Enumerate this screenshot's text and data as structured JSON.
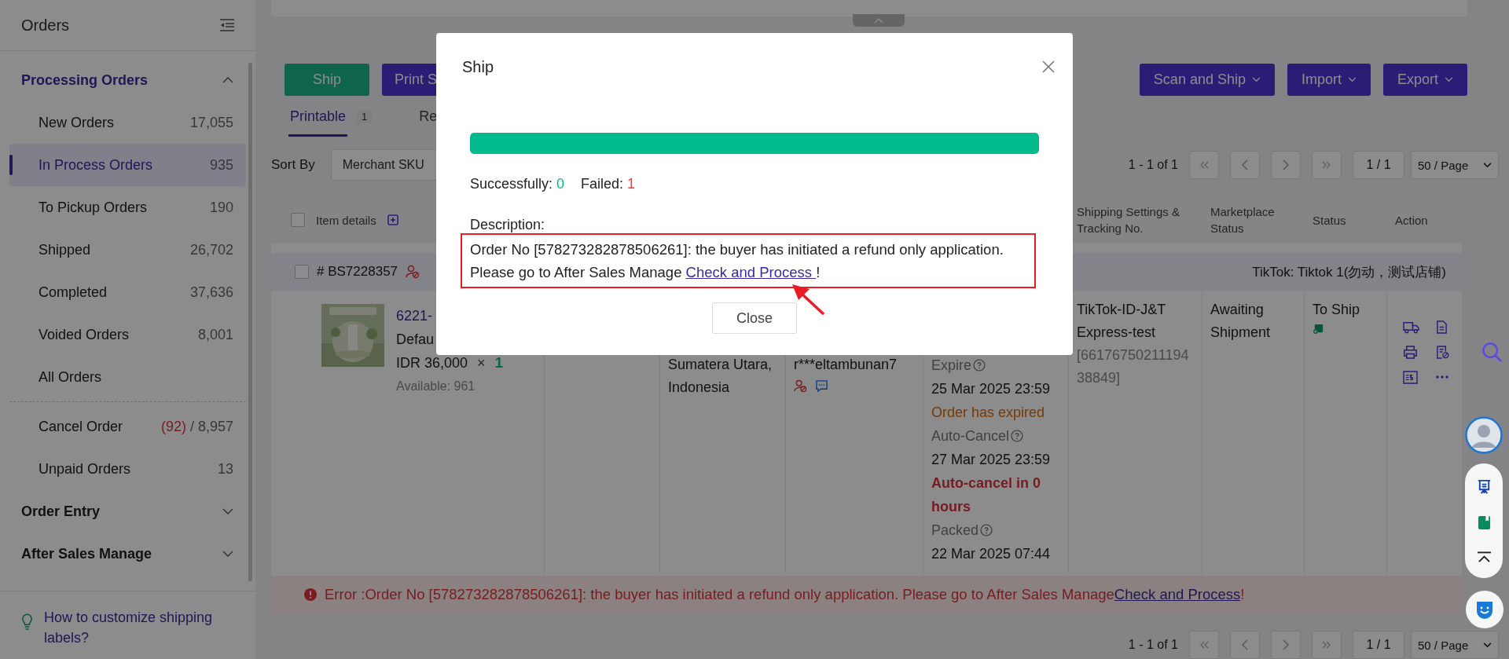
{
  "sidebar": {
    "title": "Orders",
    "groups": [
      {
        "label": "Processing Orders",
        "expanded": true,
        "items": [
          {
            "label": "New Orders",
            "count": "17,055",
            "selected": false
          },
          {
            "label": "In Process Orders",
            "count": "935",
            "selected": true
          },
          {
            "label": "To Pickup Orders",
            "count": "190",
            "selected": false
          },
          {
            "label": "Shipped",
            "count": "26,702",
            "selected": false
          },
          {
            "label": "Completed",
            "count": "37,636",
            "selected": false
          },
          {
            "label": "Voided Orders",
            "count": "8,001",
            "selected": false
          },
          {
            "label": "All Orders",
            "selected": false
          }
        ],
        "extra_items": [
          {
            "label": "Cancel Order",
            "alert_count": "(92)",
            "count": "/ 8,957",
            "selected": false
          },
          {
            "label": "Unpaid Orders",
            "count": "13",
            "selected": false
          }
        ]
      },
      {
        "label": "Order Entry",
        "expanded": false
      },
      {
        "label": "After Sales Manage",
        "expanded": false
      }
    ],
    "help_link": "How to customize shipping labels?"
  },
  "toolbar": {
    "left_buttons": [
      {
        "label": "Ship",
        "kind": "primary"
      },
      {
        "label": "Print S",
        "kind": "secondary"
      }
    ],
    "right_buttons": [
      "Scan and Ship",
      "Import",
      "Export"
    ]
  },
  "tabs": [
    {
      "label": "Printable",
      "count": "1",
      "selected": true
    },
    {
      "label": "Re",
      "selected": false
    }
  ],
  "sort": {
    "label": "Sort By",
    "value": "Merchant SKU"
  },
  "pagination_top": {
    "range": "1 - 1 of 1",
    "page": "1 / 1",
    "page_size": "50 / Page"
  },
  "table": {
    "select_all_checked": false,
    "columns": [
      "Item details",
      "Shipping Settings & Tracking No.",
      "Marketplace Status",
      "Status",
      "Action"
    ],
    "order": {
      "order_no": "# BS7228357",
      "checked": false,
      "store": "TikTok: Tiktok 1(勿动，测试店铺)",
      "item": {
        "title": "6221-",
        "variant": "Defau",
        "price": "IDR 36,000",
        "multiply": "×",
        "quantity": "1",
        "available": "Available: 961"
      },
      "address": "Sumatera Utara, Indonesia",
      "buyer": "r***eltambunan7",
      "timeline": [
        {
          "kind": "label",
          "text": "Expire"
        },
        {
          "kind": "date",
          "text": "25 Mar 2025 23:59"
        },
        {
          "kind": "warning",
          "text": "Order has expired"
        },
        {
          "kind": "label",
          "text": "Auto-Cancel"
        },
        {
          "kind": "date",
          "text": "27 Mar 2025 23:59"
        },
        {
          "kind": "alert",
          "text": "Auto-cancel in 0 hours"
        },
        {
          "kind": "label",
          "text": "Packed"
        },
        {
          "kind": "date",
          "text": "22 Mar 2025 07:44"
        }
      ],
      "carrier": "TikTok-ID-J&T Express-test",
      "tracking": "[6617675021119438849]",
      "marketplace_status": "Awaiting Shipment",
      "status": "To Ship"
    }
  },
  "error": {
    "prefix": "Error :Order No [578273282878506261]: the buyer has initiated a refund only application. Please go to After Sales Manage",
    "link": "Check and Process",
    "suffix": "!"
  },
  "pagination_bottom": {
    "range": "1 - 1 of 1",
    "page": "1 / 1",
    "page_size": "50 / Page"
  },
  "modal": {
    "title": "Ship",
    "progress": {
      "level": 1
    },
    "success_label": "Successfully:",
    "success_count": "0",
    "failed_label": "Failed:",
    "failed_count": "1",
    "description_label": "Description:",
    "message_line": "Order No [578273282878506261]: the buyer has initiated a refund only application.",
    "message_prefix": "Please go to After Sales Manage",
    "link": "Check and Process ",
    "suffix": "!",
    "close": "Close"
  }
}
